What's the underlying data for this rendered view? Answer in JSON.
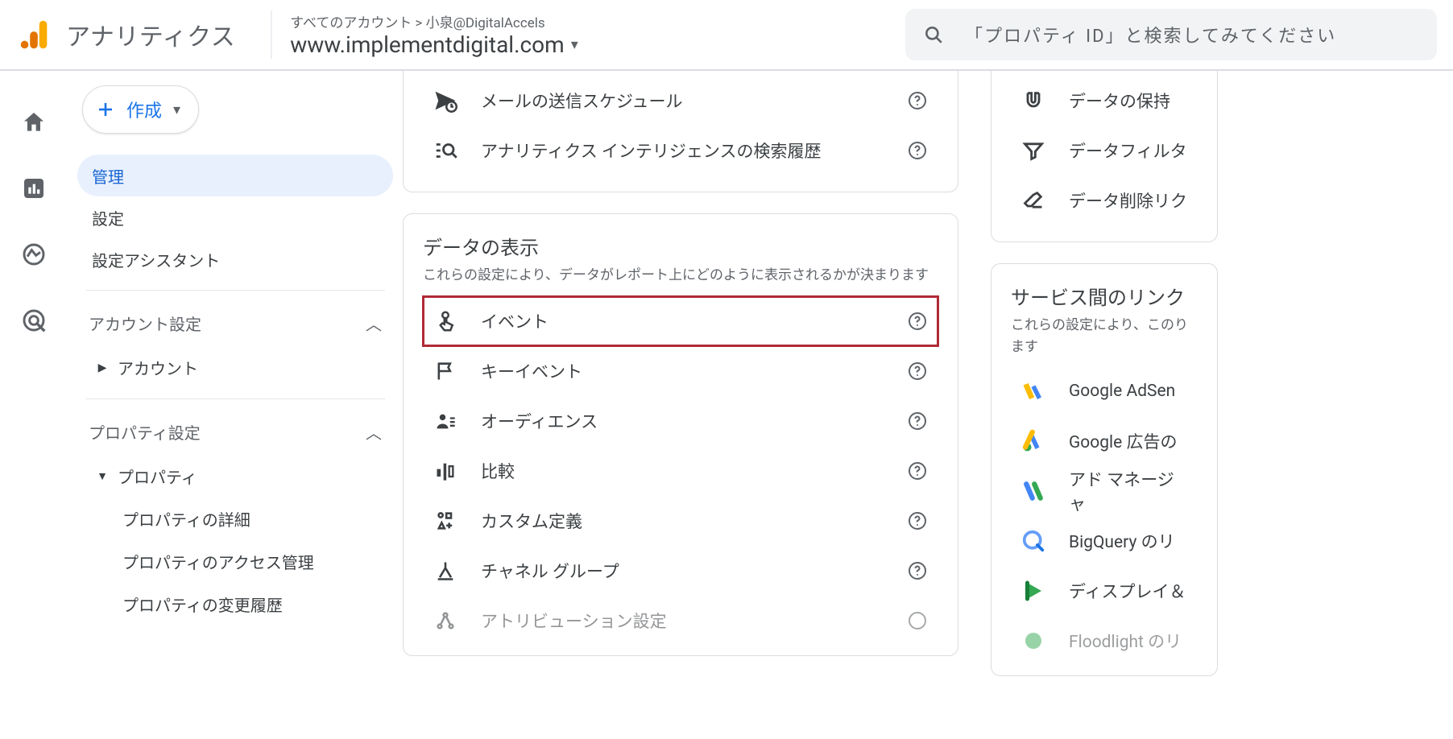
{
  "header": {
    "app_title": "アナリティクス",
    "breadcrumb": "すべてのアカウント > 小泉@DigitalAccels",
    "property_name": "www.implementdigital.com",
    "search_placeholder": "「プロパティ ID」と検索してみてください"
  },
  "sidebar": {
    "create_label": "作成",
    "items": {
      "admin": "管理",
      "settings": "設定",
      "assistant": "設定アシスタント"
    },
    "group_account": "アカウント設定",
    "account_item": "アカウント",
    "group_property": "プロパティ設定",
    "property_item": "プロパティ",
    "property_children": {
      "details": "プロパティの詳細",
      "access": "プロパティのアクセス管理",
      "history": "プロパティの変更履歴"
    }
  },
  "panel_top": {
    "mail_schedule": "メールの送信スケジュール",
    "search_history": "アナリティクス インテリジェンスの検索履歴"
  },
  "panel_display": {
    "title": "データの表示",
    "desc": "これらの設定により、データがレポート上にどのように表示されるかが決まります",
    "events": "イベント",
    "key_events": "キーイベント",
    "audiences": "オーディエンス",
    "compare": "比較",
    "custom_def": "カスタム定義",
    "channel_group": "チャネル グループ",
    "attribution": "アトリビューション設定"
  },
  "panel_right_top": {
    "data_retention": "データの保持",
    "data_filter": "データフィルタ",
    "data_delete": "データ削除リク"
  },
  "panel_links": {
    "title": "サービス間のリンク",
    "desc": "これらの設定により、このります",
    "adsense": "Google AdSen",
    "ads": "Google 広告の",
    "admanager": "アド マネージャ",
    "bigquery": "BigQuery のリ",
    "display": "ディスプレイ＆",
    "floodlight": "Floodlight のリ"
  }
}
